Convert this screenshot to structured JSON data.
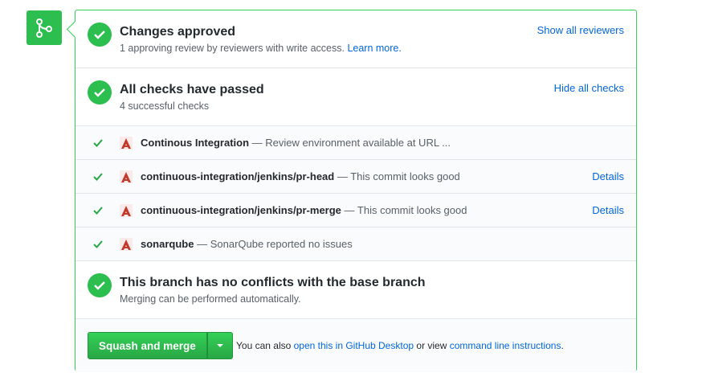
{
  "review": {
    "title": "Changes approved",
    "subtitle": "1 approving review by reviewers with write access.",
    "learn_more": "Learn more.",
    "show_reviewers": "Show all reviewers"
  },
  "checks": {
    "title": "All checks have passed",
    "subtitle": "4 successful checks",
    "hide_checks": "Hide all checks",
    "items": [
      {
        "name": "Continous Integration",
        "description": "— Review environment available at URL ...",
        "details": ""
      },
      {
        "name": "continuous-integration/jenkins/pr-head",
        "description": "— This commit looks good",
        "details": "Details"
      },
      {
        "name": "continuous-integration/jenkins/pr-merge",
        "description": "— This commit looks good",
        "details": "Details"
      },
      {
        "name": "sonarqube",
        "description": "— SonarQube reported no issues",
        "details": ""
      }
    ]
  },
  "conflicts": {
    "title": "This branch has no conflicts with the base branch",
    "subtitle": "Merging can be performed automatically."
  },
  "merge": {
    "button_label": "Squash and merge",
    "alt_prefix": "You can also",
    "desktop_link": "open this in GitHub Desktop",
    "alt_middle": "or view",
    "cli_link": "command line instructions",
    "alt_suffix": "."
  },
  "icons": {
    "merge_badge": "git-merge-icon",
    "status": "check-icon",
    "app_logo": "ci-app-logo-icon",
    "dropdown": "caret-down-icon"
  },
  "colors": {
    "success": "#2cbe4e",
    "border_success": "#34d058",
    "link": "#0366d6",
    "app_logo": "#c0392b"
  }
}
